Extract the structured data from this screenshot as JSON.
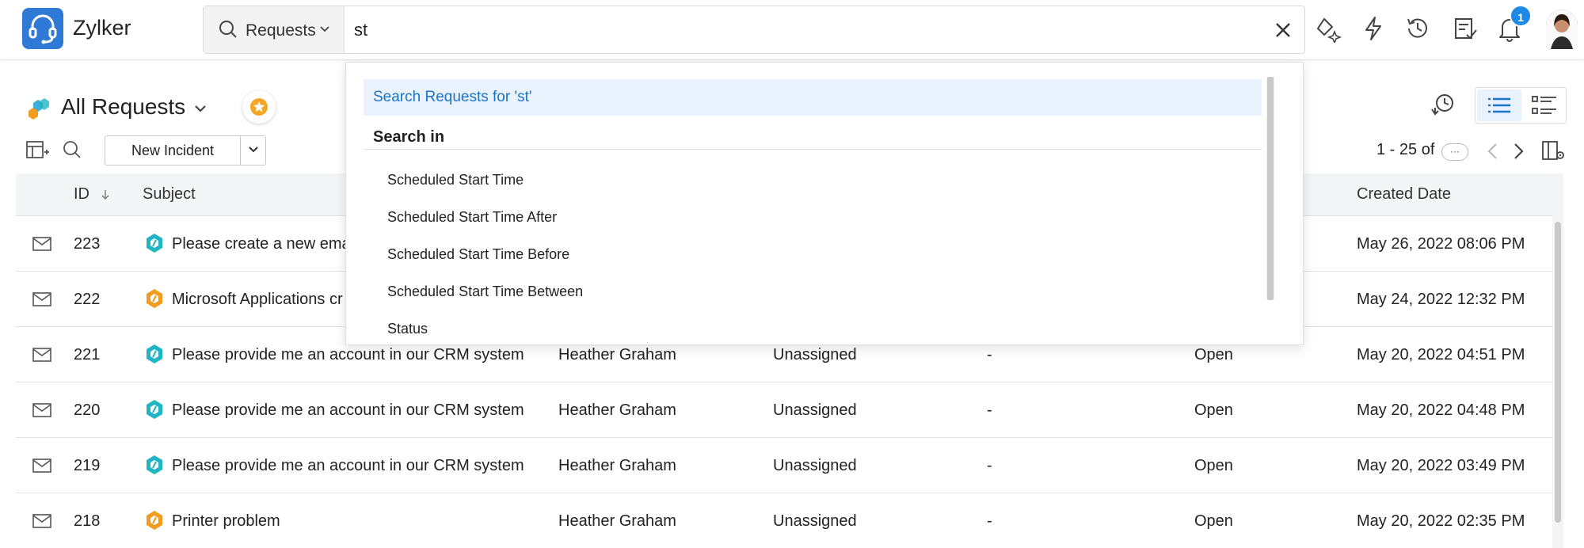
{
  "app": {
    "name": "Zylker"
  },
  "search": {
    "scope_label": "Requests",
    "query": "st"
  },
  "notifications": {
    "count": "1"
  },
  "page": {
    "title": "All Requests",
    "new_button_label": "New Incident",
    "pagination": "1 - 25 of",
    "pagination_more": "···"
  },
  "table": {
    "headers": {
      "id": "ID",
      "subject": "Subject",
      "created": "Created Date"
    },
    "rows": [
      {
        "id": "223",
        "subject": "Please create a new ema",
        "requester": "",
        "technician": "",
        "group": "",
        "status": "",
        "created": "May 26, 2022 08:06 PM",
        "priority_color": "#1fb5c4"
      },
      {
        "id": "222",
        "subject": "Microsoft Applications cr",
        "requester": "",
        "technician": "",
        "group": "",
        "status": "",
        "created": "May 24, 2022 12:32 PM",
        "priority_color": "#f39c1f"
      },
      {
        "id": "221",
        "subject": "Please provide me an account in our CRM system",
        "requester": "Heather Graham",
        "technician": "Unassigned",
        "group": "-",
        "status": "Open",
        "created": "May 20, 2022 04:51 PM",
        "priority_color": "#1fb5c4"
      },
      {
        "id": "220",
        "subject": "Please provide me an account in our CRM system",
        "requester": "Heather Graham",
        "technician": "Unassigned",
        "group": "-",
        "status": "Open",
        "created": "May 20, 2022 04:48 PM",
        "priority_color": "#1fb5c4"
      },
      {
        "id": "219",
        "subject": "Please provide me an account in our CRM system",
        "requester": "Heather Graham",
        "technician": "Unassigned",
        "group": "-",
        "status": "Open",
        "created": "May 20, 2022 03:49 PM",
        "priority_color": "#1fb5c4"
      },
      {
        "id": "218",
        "subject": "Printer problem",
        "requester": "Heather Graham",
        "technician": "Unassigned",
        "group": "-",
        "status": "Open",
        "created": "May 20, 2022 02:35 PM",
        "priority_color": "#f39c1f"
      }
    ]
  },
  "dropdown": {
    "search_for": "Search Requests for 'st'",
    "section": "Search in",
    "items": [
      "Scheduled Start Time",
      "Scheduled Start Time After",
      "Scheduled Start Time Before",
      "Scheduled Start Time Between",
      "Status"
    ]
  },
  "colors": {
    "accent": "#1a73c8",
    "brand": "#2e7ad6",
    "badge": "#1e88e5",
    "star": "#f5a623"
  },
  "icons": [
    "headset-logo-icon",
    "search-icon",
    "chevron-down-icon",
    "close-icon",
    "zia-sparkle-icon",
    "lightning-icon",
    "history-icon",
    "task-list-icon",
    "bell-icon",
    "filter-view-icon",
    "star-icon",
    "mail-icon",
    "list-view-icon",
    "detail-view-icon",
    "column-settings-icon"
  ]
}
